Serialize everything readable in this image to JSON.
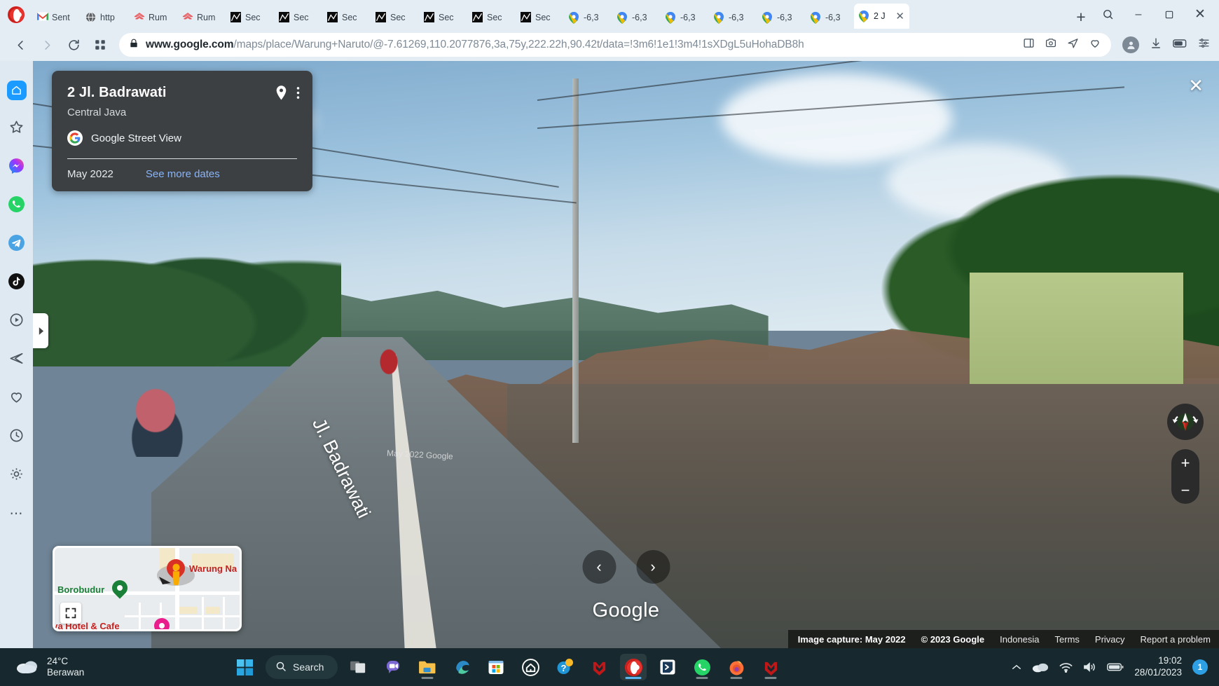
{
  "browser": {
    "name": "opera-browser",
    "tabs": [
      {
        "title": "Sent",
        "icon": "gmail-icon"
      },
      {
        "title": "http",
        "icon": "globe-icon"
      },
      {
        "title": "Rum",
        "icon": "rumah-icon"
      },
      {
        "title": "Rum",
        "icon": "rumah-icon"
      },
      {
        "title": "Sec",
        "icon": "chart-icon"
      },
      {
        "title": "Sec",
        "icon": "chart-icon"
      },
      {
        "title": "Sec",
        "icon": "chart-icon"
      },
      {
        "title": "Sec",
        "icon": "chart-icon"
      },
      {
        "title": "Sec",
        "icon": "chart-icon"
      },
      {
        "title": "Sec",
        "icon": "chart-icon"
      },
      {
        "title": "Sec",
        "icon": "chart-icon"
      },
      {
        "title": "-6,3",
        "icon": "maps-pin-icon"
      },
      {
        "title": "-6,3",
        "icon": "maps-pin-icon"
      },
      {
        "title": "-6,3",
        "icon": "maps-pin-icon"
      },
      {
        "title": "-6,3",
        "icon": "maps-pin-icon"
      },
      {
        "title": "-6,3",
        "icon": "maps-pin-icon"
      },
      {
        "title": "-6,3",
        "icon": "maps-pin-icon"
      }
    ],
    "active_tab": {
      "title": "2 J",
      "icon": "maps-pin-icon",
      "close": "✕"
    },
    "new_tab_label": "+",
    "window_controls": {
      "minimize": "–",
      "maximize": "❐",
      "close": "✕"
    },
    "nav": {
      "back": "‹",
      "forward": "›",
      "reload": "↻",
      "tiles": "speed-dial"
    },
    "url": {
      "domain": "www.google.com",
      "path": "/maps/place/Warung+Naruto/@-7.61269,110.2077876,3a,75y,222.22h,90.42t/data=!3m6!1e1!3m4!1sXDgL5uHohaDB8h",
      "secure_icon": "lock-icon"
    }
  },
  "sidebar": {
    "items": [
      {
        "name": "home",
        "icon": "home-icon"
      },
      {
        "name": "bookmarks",
        "icon": "star-icon"
      },
      {
        "name": "messenger",
        "icon": "messenger-icon"
      },
      {
        "name": "whatsapp",
        "icon": "whatsapp-icon"
      },
      {
        "name": "telegram",
        "icon": "telegram-icon"
      },
      {
        "name": "tiktok",
        "icon": "tiktok-icon"
      },
      {
        "name": "player",
        "icon": "play-circle-icon"
      },
      {
        "name": "send",
        "icon": "send-icon"
      },
      {
        "name": "favorites",
        "icon": "heart-icon"
      },
      {
        "name": "history",
        "icon": "clock-icon"
      },
      {
        "name": "settings",
        "icon": "gear-icon"
      }
    ],
    "more_label": "⋯"
  },
  "infocard": {
    "title": "2 Jl. Badrawati",
    "subtitle": "Central Java",
    "source": "Google Street View",
    "source_badge": "G",
    "date": "May 2022",
    "more_dates": "See more dates",
    "pin_icon": "location-pin-icon",
    "menu_icon": "more-vert-icon"
  },
  "panorama": {
    "close_label": "✕",
    "street_name": "Jl. Badrawati",
    "inline_attribution": "May 2022 Google",
    "prev_label": "‹",
    "next_label": "›",
    "watermark": "Google",
    "expander_label": "▸"
  },
  "attribution": {
    "capture": "Image capture: May 2022",
    "copyright": "© 2023 Google",
    "links": [
      "Indonesia",
      "Terms",
      "Privacy",
      "Report a problem"
    ]
  },
  "minimap": {
    "labels": [
      {
        "text": "Borobudur",
        "color": "#1a7f37"
      },
      {
        "text": "Warung Na",
        "color": "#c5221f"
      },
      {
        "text": "aya Hotel & Cafe",
        "color": "#c5221f"
      }
    ],
    "expand_icon": "fullscreen-icon",
    "pegman_icon": "pegman-icon"
  },
  "map_controls": {
    "compass_icon": "compass-icon",
    "zoom_in": "+",
    "zoom_out": "−"
  },
  "taskbar": {
    "weather": {
      "temperature": "24°C",
      "condition": "Berawan",
      "icon": "cloud-icon"
    },
    "search_placeholder": "Search",
    "items": [
      {
        "name": "start",
        "icon": "windows-icon"
      },
      {
        "name": "task-view",
        "icon": "task-view-icon"
      },
      {
        "name": "chat",
        "icon": "chat-icon"
      },
      {
        "name": "file-explorer",
        "icon": "folder-icon"
      },
      {
        "name": "edge",
        "icon": "edge-icon"
      },
      {
        "name": "microsoft-store",
        "icon": "store-icon"
      },
      {
        "name": "house-app",
        "icon": "house-icon"
      },
      {
        "name": "help",
        "icon": "question-icon"
      },
      {
        "name": "mcafee",
        "icon": "shield-icon"
      },
      {
        "name": "opera",
        "icon": "opera-icon"
      },
      {
        "name": "app-blue",
        "icon": "arrow-box-icon"
      },
      {
        "name": "whatsapp",
        "icon": "whatsapp-icon"
      },
      {
        "name": "firefox",
        "icon": "firefox-icon"
      },
      {
        "name": "mcafee-2",
        "icon": "shield-icon"
      }
    ],
    "tray": {
      "chevron": "⌃",
      "onedrive": "cloud-icon",
      "wifi": "wifi-icon",
      "volume": "speaker-icon",
      "battery": "battery-icon",
      "time": "19:02",
      "date": "28/01/2023",
      "notification_count": "1"
    }
  },
  "colors": {
    "accent_blue": "#8ab4f8",
    "card_bg": "#3c4043",
    "taskbar_bg": "#17292e",
    "google_red": "#c5221f",
    "google_green": "#1a7f37"
  }
}
